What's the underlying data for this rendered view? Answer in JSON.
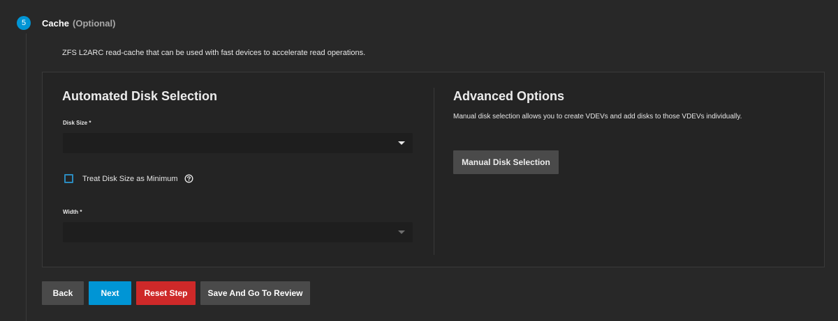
{
  "step": {
    "number": "5",
    "title": "Cache",
    "optional": "(Optional)",
    "description": "ZFS L2ARC read-cache that can be used with fast devices to accelerate read operations."
  },
  "automated": {
    "title": "Automated Disk Selection",
    "disk_size_label": "Disk Size *",
    "disk_size_value": "",
    "treat_min_label": "Treat Disk Size as Minimum",
    "treat_min_checked": false,
    "width_label": "Width *",
    "width_value": ""
  },
  "advanced": {
    "title": "Advanced Options",
    "description": "Manual disk selection allows you to create VDEVs and add disks to those VDEVs individually.",
    "manual_button": "Manual Disk Selection"
  },
  "actions": {
    "back": "Back",
    "next": "Next",
    "reset": "Reset Step",
    "review": "Save And Go To Review"
  },
  "colors": {
    "accent": "#0095d5",
    "danger": "#ce2929",
    "background": "#282828"
  }
}
